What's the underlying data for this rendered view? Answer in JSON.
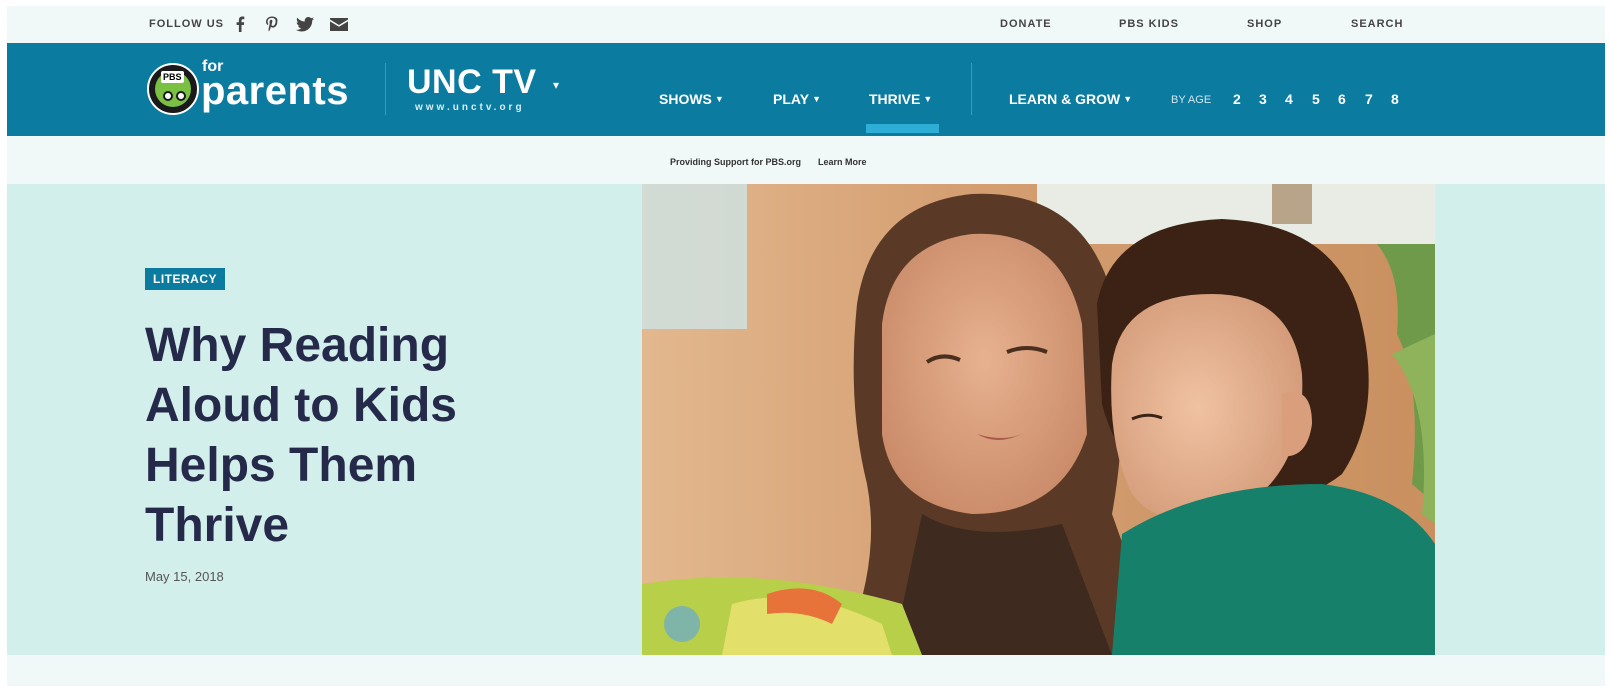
{
  "utility_bar": {
    "follow_label": "FOLLOW US",
    "social_icons": [
      "facebook-icon",
      "pinterest-icon",
      "twitter-icon",
      "email-icon"
    ],
    "links": [
      "DONATE",
      "PBS KIDS",
      "SHOP",
      "SEARCH"
    ]
  },
  "brand": {
    "pbs_badge": "PBS",
    "for_text": "for",
    "parents_text": "parents",
    "station_name": "UNC TV",
    "station_url": "www.unctv.org"
  },
  "nav": {
    "items": [
      {
        "label": "SHOWS",
        "active": false
      },
      {
        "label": "PLAY",
        "active": false
      },
      {
        "label": "THRIVE",
        "active": true
      },
      {
        "label": "LEARN & GROW",
        "active": false
      }
    ],
    "by_age_label": "BY AGE",
    "ages": [
      "2",
      "3",
      "4",
      "5",
      "6",
      "7",
      "8"
    ]
  },
  "sponsor": {
    "text": "Providing Support for PBS.org",
    "link": "Learn More"
  },
  "hero": {
    "tag": "LITERACY",
    "title": "Why Reading Aloud to Kids Helps Them Thrive",
    "date": "May 15, 2018"
  },
  "colors": {
    "nav_bg": "#0b7ba0",
    "hero_bg": "#d3efeb",
    "title": "#262a4a",
    "active_indicator": "#2eaed6"
  }
}
